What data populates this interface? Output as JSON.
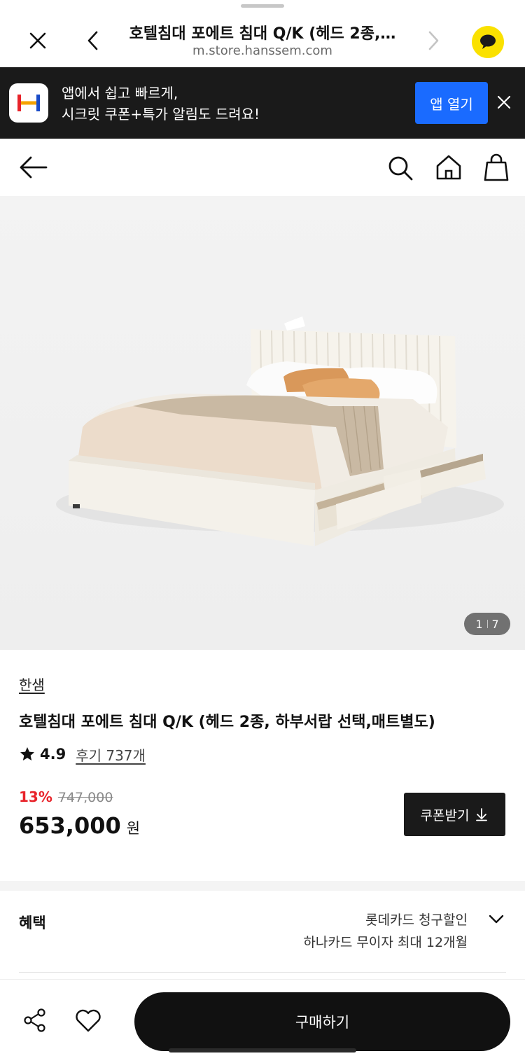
{
  "browser": {
    "title": "호텔침대 포에트 침대 Q/K (헤드 2종,…",
    "url": "m.store.hanssem.com"
  },
  "app_banner": {
    "line1": "앱에서 쉽고 빠르게,",
    "line2": "시크릿 쿠폰+특가 알림도 드려요!",
    "open_button": "앱 열기"
  },
  "gallery": {
    "current": "1",
    "total": "7"
  },
  "product": {
    "brand": "한샘",
    "title": "호텔침대 포에트 침대 Q/K (헤드 2종, 하부서랍 선택,매트별도)",
    "rating": "4.9",
    "reviews": "후기 737개",
    "discount": "13%",
    "original_price": "747,000",
    "price": "653,000",
    "currency": "원",
    "coupon_button": "쿠폰받기"
  },
  "benefits": {
    "label": "혜택",
    "line1": "롯데카드 청구할인",
    "line2": "하나카드 무이자 최대 12개월"
  },
  "bottom_bar": {
    "buy_button": "구매하기"
  },
  "colors": {
    "accent_blue": "#1a6bff",
    "discount_red": "#e8232a",
    "kakao_yellow": "#fae100",
    "dark": "#111111"
  }
}
